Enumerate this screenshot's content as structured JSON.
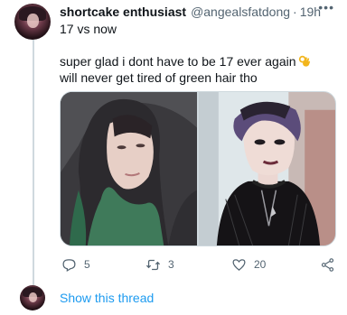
{
  "tweet": {
    "display_name": "shortcake enthusiast",
    "handle": "@angealsfatdong",
    "separator": "·",
    "time": "19h",
    "more_icon": "ellipsis-icon",
    "line1": "17 vs now",
    "text_before_emoji": "super glad i dont have to be 17 ever again",
    "emoji_icon": "ok-hand-emoji-icon",
    "text_after_emoji": " will never get tired of green hair tho"
  },
  "media": {
    "left_photo_icon": "photo-girl-green-hair",
    "right_photo_icon": "photo-goth-purple-hair"
  },
  "actions": {
    "reply_count": "5",
    "retweet_count": "3",
    "like_count": "20"
  },
  "thread": {
    "show_label": "Show this thread"
  },
  "colors": {
    "link": "#1d9bf0",
    "secondary_text": "#536471",
    "primary_text": "#0f1419",
    "thread_line": "#cfd9de"
  }
}
